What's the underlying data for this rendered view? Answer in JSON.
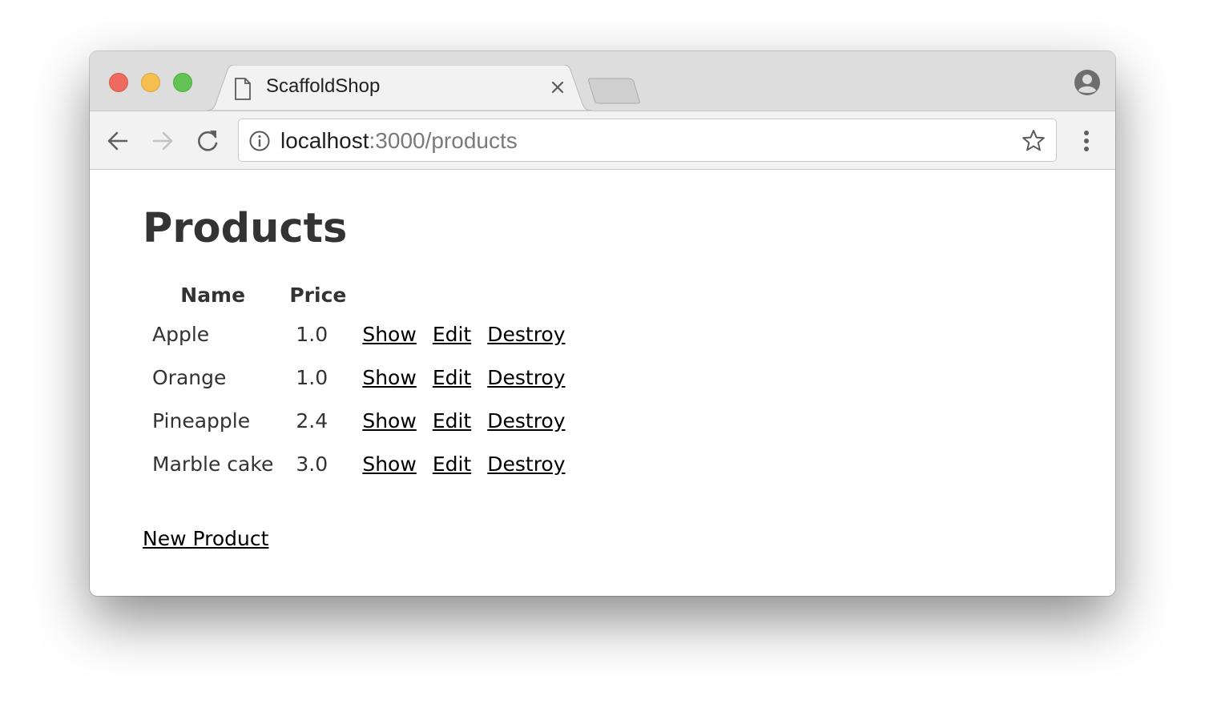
{
  "browser": {
    "tab": {
      "title": "ScaffoldShop",
      "favicon": "page-icon",
      "close_icon": "close-icon"
    },
    "new_tab_icon": "new-tab-icon",
    "profile_icon": "profile-icon",
    "toolbar": {
      "back_icon": "arrow-left-icon",
      "forward_icon": "arrow-right-icon",
      "reload_icon": "reload-icon",
      "info_icon": "info-icon",
      "url_host": "localhost",
      "url_path": ":3000/products",
      "bookmark_icon": "star-icon",
      "menu_icon": "kebab-menu-icon"
    },
    "colors": {
      "close": "#ee6a5e",
      "minimize": "#f5bf4f",
      "maximize": "#61c454"
    }
  },
  "page": {
    "title": "Products",
    "table": {
      "headers": [
        "Name",
        "Price"
      ],
      "rows": [
        {
          "name": "Apple",
          "price": "1.0",
          "show": "Show",
          "edit": "Edit",
          "destroy": "Destroy"
        },
        {
          "name": "Orange",
          "price": "1.0",
          "show": "Show",
          "edit": "Edit",
          "destroy": "Destroy"
        },
        {
          "name": "Pineapple",
          "price": "2.4",
          "show": "Show",
          "edit": "Edit",
          "destroy": "Destroy"
        },
        {
          "name": "Marble cake",
          "price": "3.0",
          "show": "Show",
          "edit": "Edit",
          "destroy": "Destroy"
        }
      ]
    },
    "new_link": "New Product"
  }
}
